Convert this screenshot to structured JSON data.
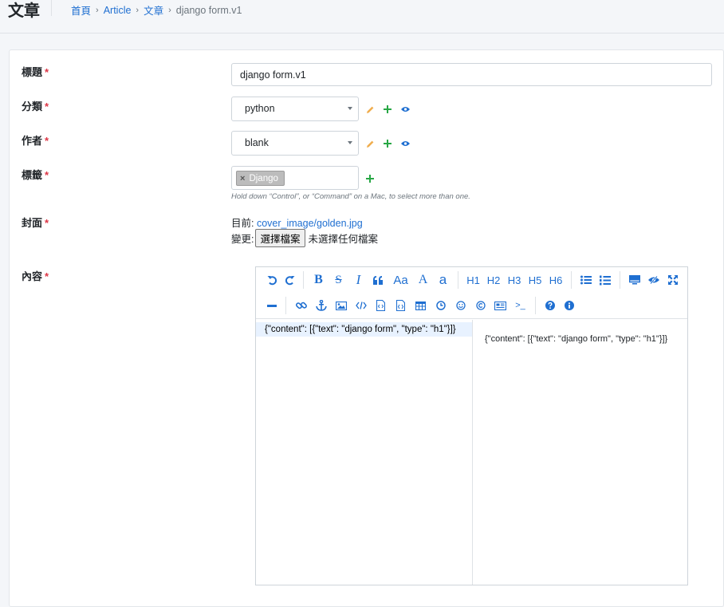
{
  "header": {
    "title": "文章",
    "breadcrumb": [
      "首頁",
      "Article",
      "文章"
    ],
    "current": "django form.v1"
  },
  "form": {
    "title": {
      "label": "標題",
      "value": "django form.v1"
    },
    "category": {
      "label": "分類",
      "value": "python"
    },
    "author": {
      "label": "作者",
      "value": "blank"
    },
    "tags": {
      "label": "標籤",
      "chip": "Django",
      "remove": "×",
      "help": "Hold down “Control”, or “Command” on a Mac, to select more than one."
    },
    "cover": {
      "label": "封面",
      "current_prefix": "目前:",
      "current_file": "cover_image/golden.jpg",
      "change_prefix": "變更:",
      "choose_button": "選擇檔案",
      "no_file": "未選擇任何檔案"
    },
    "content": {
      "label": "內容",
      "code": "{\"content\": [{\"text\": \"django form\", \"type\": \"h1\"}]}",
      "preview": "{\"content\": [{\"text\": \"django form\", \"type\": \"h1\"}]}"
    },
    "required_mark": "*"
  },
  "toolbar": {
    "heading_labels": [
      "H1",
      "H2",
      "H3",
      "H5",
      "H6"
    ],
    "font_labels": [
      "B",
      "S",
      "I",
      "Aa",
      "A",
      "a"
    ],
    "terminal_label": ">_"
  },
  "colors": {
    "accent": "#1f6fd1",
    "required": "#dc3545",
    "edit": "#f0ad4e",
    "add": "#28a745",
    "chip": "#bcbcbc"
  }
}
